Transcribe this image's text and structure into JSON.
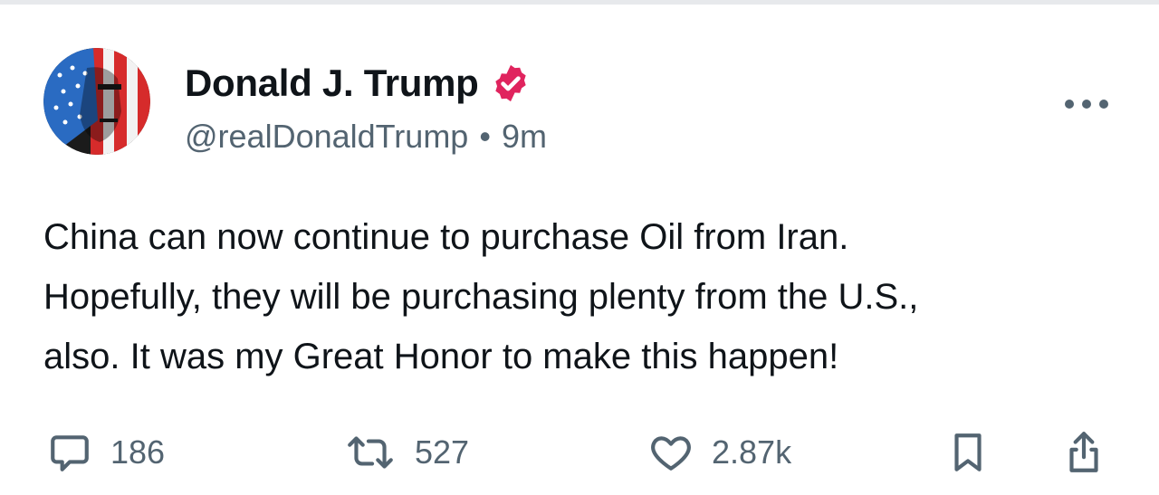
{
  "author": {
    "display_name": "Donald J. Trump",
    "handle": "@realDonaldTrump",
    "separator": "•",
    "time_ago": "9m",
    "verified": true,
    "avatar_icon": "flag-portrait-avatar",
    "verified_icon": "verified-badge-icon"
  },
  "post": {
    "lines": [
      "China can now continue to purchase Oil from Iran.",
      "Hopefully, they will be purchasing plenty from the U.S.,",
      "also. It was my Great Honor to make this happen!"
    ]
  },
  "actions": {
    "replies": {
      "icon": "reply-bubble-icon",
      "count": "186"
    },
    "reposts": {
      "icon": "repost-arrows-icon",
      "count": "527"
    },
    "likes": {
      "icon": "heart-icon",
      "count": "2.87k"
    },
    "bookmark": {
      "icon": "bookmark-icon"
    },
    "share": {
      "icon": "share-icon"
    }
  },
  "menu": {
    "icon": "more-dots-icon"
  },
  "colors": {
    "text_primary": "#0f1419",
    "text_secondary": "#536471",
    "verified_badge": "#e0245e",
    "divider": "#e7e9ec"
  }
}
